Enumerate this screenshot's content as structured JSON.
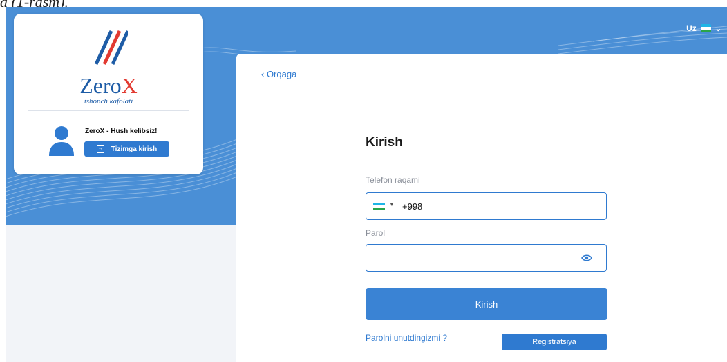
{
  "doc_caption": "a (1-rasm).",
  "language": {
    "code": "Uz",
    "flag_icon": "uzbekistan-flag-icon"
  },
  "logo": {
    "name_main": "Zero",
    "name_x": "X",
    "tagline": "ishonch kafolati"
  },
  "user_card": {
    "welcome": "ZeroX - Hush kelibsiz!",
    "login_button": "Tizimga kirish"
  },
  "form": {
    "back_label": "‹ Orqaga",
    "title": "Kirish",
    "phone_label": "Telefon raqami",
    "phone_value": "+998",
    "password_label": "Parol",
    "password_value": "",
    "submit_label": "Kirish",
    "forgot_label": "Parolni unutdingizmi ?",
    "register_label": "Registratsiya"
  },
  "colors": {
    "banner": "#4a8fd6",
    "primary": "#2f7ad0",
    "logo_blue": "#1e5ca6",
    "logo_red": "#e23a31"
  }
}
